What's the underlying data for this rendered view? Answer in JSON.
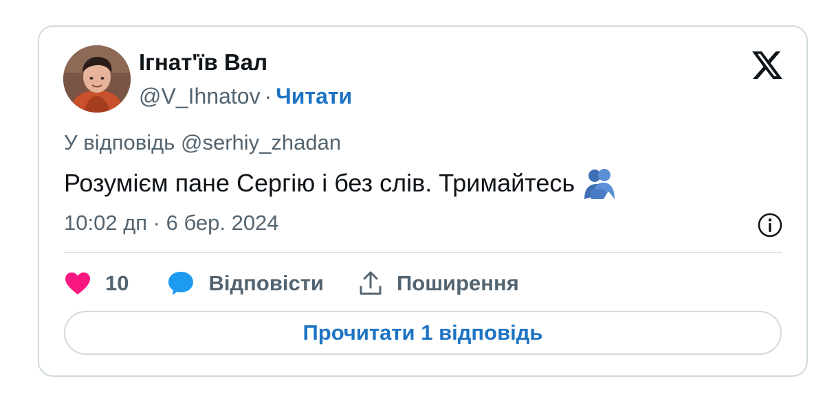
{
  "author": {
    "name": "Ігнат'їв Вал",
    "handle": "@V_Ihnatov",
    "separator": "·",
    "follow_label": "Читати"
  },
  "tweet": {
    "reply_to": "У відповідь @serhiy_zhadan",
    "text": "Розумієм пане Сергію і без слів. Тримайтесь",
    "emoji": "people-hugging-emoji",
    "timestamp": "10:02 дп · 6 бер. 2024"
  },
  "actions": {
    "like_count": "10",
    "reply_label": "Відповісти",
    "share_label": "Поширення"
  },
  "read_replies_label": "Прочитати 1 відповідь",
  "icons": {
    "brand": "x-logo-icon",
    "info": "info-icon",
    "like": "heart-icon",
    "reply": "speech-bubble-icon",
    "share": "share-icon"
  },
  "colors": {
    "link": "#1d73c3",
    "like": "#f91880",
    "reply": "#1d9bf0",
    "text": "#0f1419",
    "muted": "#536471",
    "border": "#cfd9de"
  }
}
